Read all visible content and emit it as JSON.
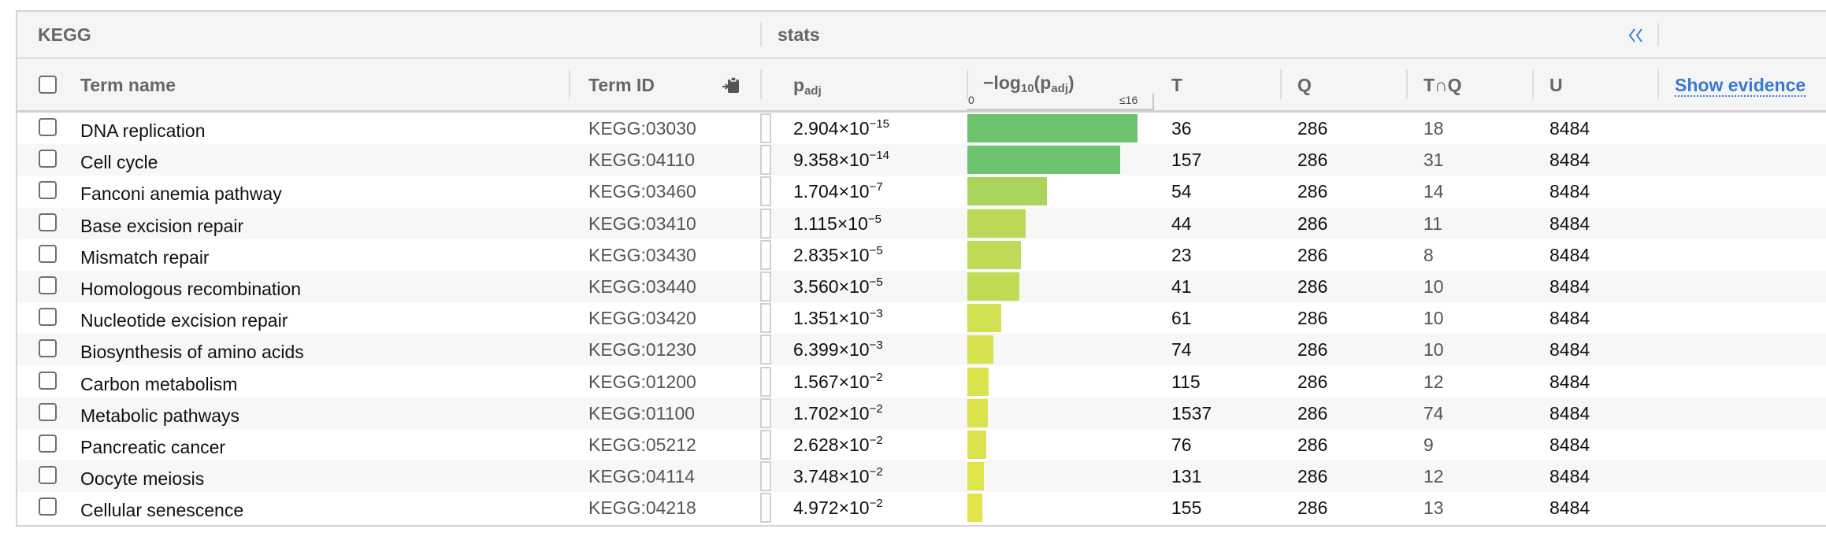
{
  "group_headers": {
    "kegg": "KEGG",
    "stats": "stats"
  },
  "columns": {
    "term_name": "Term name",
    "term_id": "Term ID",
    "padj_main": "p",
    "padj_sub": "adj",
    "log_prefix": "−log",
    "log_sub_10": "10",
    "log_open": "(p",
    "log_sub_adj": "adj",
    "log_close": ")",
    "axis_min": "0",
    "axis_max": "≤16",
    "t": "T",
    "q": "Q",
    "tq": "T∩Q",
    "u": "U",
    "show_evidence": "Show evidence"
  },
  "icons": {
    "collapse": "double-chevron-left-icon",
    "copy": "copy-clipboard-icon"
  },
  "colors": {
    "link": "#3a78d6",
    "bar_low": "#e2e54a",
    "bar_high": "#6cc26e"
  },
  "bar_axis_max": 16,
  "rows": [
    {
      "name": "DNA replication",
      "id": "KEGG:03030",
      "padj_mant": "2.904",
      "padj_exp": "-15",
      "neglog10": 14.54,
      "t": "36",
      "q": "286",
      "tq": "18",
      "u": "8484"
    },
    {
      "name": "Cell cycle",
      "id": "KEGG:04110",
      "padj_mant": "9.358",
      "padj_exp": "-14",
      "neglog10": 13.03,
      "t": "157",
      "q": "286",
      "tq": "31",
      "u": "8484"
    },
    {
      "name": "Fanconi anemia pathway",
      "id": "KEGG:03460",
      "padj_mant": "1.704",
      "padj_exp": "-7",
      "neglog10": 6.77,
      "t": "54",
      "q": "286",
      "tq": "14",
      "u": "8484"
    },
    {
      "name": "Base excision repair",
      "id": "KEGG:03410",
      "padj_mant": "1.115",
      "padj_exp": "-5",
      "neglog10": 4.95,
      "t": "44",
      "q": "286",
      "tq": "11",
      "u": "8484"
    },
    {
      "name": "Mismatch repair",
      "id": "KEGG:03430",
      "padj_mant": "2.835",
      "padj_exp": "-5",
      "neglog10": 4.55,
      "t": "23",
      "q": "286",
      "tq": "8",
      "u": "8484"
    },
    {
      "name": "Homologous recombination",
      "id": "KEGG:03440",
      "padj_mant": "3.560",
      "padj_exp": "-5",
      "neglog10": 4.45,
      "t": "41",
      "q": "286",
      "tq": "10",
      "u": "8484"
    },
    {
      "name": "Nucleotide excision repair",
      "id": "KEGG:03420",
      "padj_mant": "1.351",
      "padj_exp": "-3",
      "neglog10": 2.87,
      "t": "61",
      "q": "286",
      "tq": "10",
      "u": "8484"
    },
    {
      "name": "Biosynthesis of amino acids",
      "id": "KEGG:01230",
      "padj_mant": "6.399",
      "padj_exp": "-3",
      "neglog10": 2.19,
      "t": "74",
      "q": "286",
      "tq": "10",
      "u": "8484"
    },
    {
      "name": "Carbon metabolism",
      "id": "KEGG:01200",
      "padj_mant": "1.567",
      "padj_exp": "-2",
      "neglog10": 1.8,
      "t": "115",
      "q": "286",
      "tq": "12",
      "u": "8484"
    },
    {
      "name": "Metabolic pathways",
      "id": "KEGG:01100",
      "padj_mant": "1.702",
      "padj_exp": "-2",
      "neglog10": 1.77,
      "t": "1537",
      "q": "286",
      "tq": "74",
      "u": "8484"
    },
    {
      "name": "Pancreatic cancer",
      "id": "KEGG:05212",
      "padj_mant": "2.628",
      "padj_exp": "-2",
      "neglog10": 1.58,
      "t": "76",
      "q": "286",
      "tq": "9",
      "u": "8484"
    },
    {
      "name": "Oocyte meiosis",
      "id": "KEGG:04114",
      "padj_mant": "3.748",
      "padj_exp": "-2",
      "neglog10": 1.43,
      "t": "131",
      "q": "286",
      "tq": "12",
      "u": "8484"
    },
    {
      "name": "Cellular senescence",
      "id": "KEGG:04218",
      "padj_mant": "4.972",
      "padj_exp": "-2",
      "neglog10": 1.3,
      "t": "155",
      "q": "286",
      "tq": "13",
      "u": "8484"
    }
  ]
}
